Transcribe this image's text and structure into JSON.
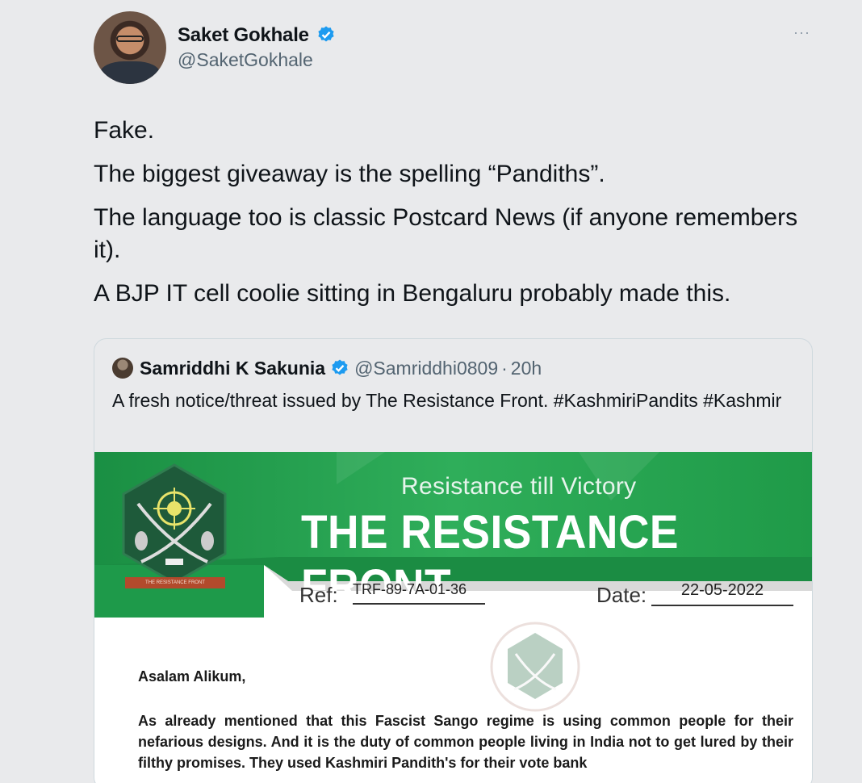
{
  "tweet": {
    "author_name": "Saket Gokhale",
    "author_handle": "@SaketGokhale",
    "more_icon": "more-icon",
    "paragraphs": [
      "Fake.",
      "The biggest giveaway is the spelling “Pandiths”.",
      "The language too is classic Postcard News (if anyone remembers it).",
      "A BJP IT cell coolie sitting in Bengaluru probably made this."
    ]
  },
  "quote": {
    "author_name": "Samriddhi K Sakunia",
    "author_handle": "@Samriddhi0809",
    "separator": "·",
    "time": "20h",
    "text": "A fresh notice/threat issued by The Resistance Front. #KashmiriPandits #Kashmir"
  },
  "notice": {
    "tagline": "Resistance till Victory",
    "org_title": "THE RESISTANCE FRONT",
    "logo_caption": "THE RESISTANCE FRONT",
    "ref_label": "Ref:",
    "ref_value": "TRF-89-7A-01-36",
    "date_label": "Date:",
    "date_value": "22-05-2022",
    "greeting": "Asalam Alikum,",
    "body": "As already mentioned that this Fascist Sango regime is using common people for their nefarious designs. And it is the duty of common people living in India not to get lured by their filthy promises. They used Kashmiri Pandith's for their vote bank"
  },
  "colors": {
    "verified": "#1d9bf0",
    "banner_green": "#1f9a48",
    "logo_green": "#1e5a3a"
  }
}
